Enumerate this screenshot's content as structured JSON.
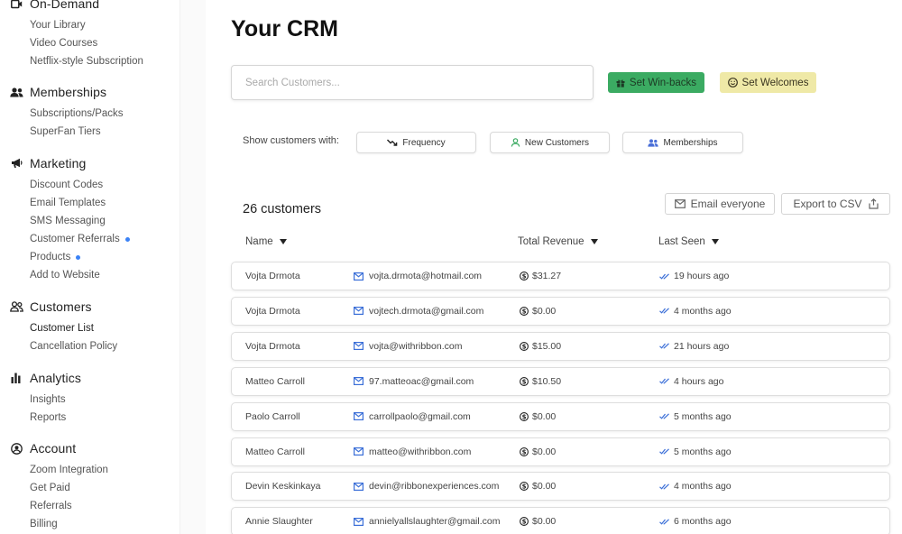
{
  "sidebar": {
    "sections": [
      {
        "label": "On-Demand",
        "icon": "video-icon",
        "items": [
          {
            "label": "Your Library"
          },
          {
            "label": "Video Courses"
          },
          {
            "label": "Netflix-style Subscription"
          }
        ]
      },
      {
        "label": "Memberships",
        "icon": "users-icon",
        "items": [
          {
            "label": "Subscriptions/Packs"
          },
          {
            "label": "SuperFan Tiers"
          }
        ]
      },
      {
        "label": "Marketing",
        "icon": "megaphone-icon",
        "items": [
          {
            "label": "Discount Codes"
          },
          {
            "label": "Email Templates"
          },
          {
            "label": "SMS Messaging"
          },
          {
            "label": "Customer Referrals",
            "dot": true
          },
          {
            "label": "Products",
            "dot": true
          },
          {
            "label": "Add to Website"
          }
        ]
      },
      {
        "label": "Customers",
        "icon": "people-outline-icon",
        "items": [
          {
            "label": "Customer List",
            "active": true
          },
          {
            "label": "Cancellation Policy"
          }
        ]
      },
      {
        "label": "Analytics",
        "icon": "bar-chart-icon",
        "items": [
          {
            "label": "Insights"
          },
          {
            "label": "Reports"
          }
        ]
      },
      {
        "label": "Account",
        "icon": "user-circle-icon",
        "items": [
          {
            "label": "Zoom Integration"
          },
          {
            "label": "Get Paid"
          },
          {
            "label": "Referrals"
          },
          {
            "label": "Billing"
          }
        ]
      }
    ]
  },
  "main": {
    "title": "Your CRM",
    "search_placeholder": "Search Customers...",
    "winback_label": "Set Win-backs",
    "welcome_label": "Set Welcomes",
    "filter_label": "Show customers with:",
    "filters": {
      "frequency": "Frequency",
      "new_customers": "New Customers",
      "memberships": "Memberships"
    },
    "count_label": "26 customers",
    "email_everyone_label": "Email everyone",
    "export_label": "Export to CSV",
    "columns": {
      "name": "Name",
      "revenue": "Total Revenue",
      "last_seen": "Last Seen"
    }
  },
  "customers": [
    {
      "name": "Vojta Drmota",
      "email": "vojta.drmota@hotmail.com",
      "revenue": "$31.27",
      "last_seen": "19 hours ago"
    },
    {
      "name": "Vojta Drmota",
      "email": "vojtech.drmota@gmail.com",
      "revenue": "$0.00",
      "last_seen": "4 months ago"
    },
    {
      "name": "Vojta Drmota",
      "email": "vojta@withribbon.com",
      "revenue": "$15.00",
      "last_seen": "21 hours ago"
    },
    {
      "name": "Matteo Carroll",
      "email": "97.matteoac@gmail.com",
      "revenue": "$10.50",
      "last_seen": "4 hours ago"
    },
    {
      "name": "Paolo Carroll",
      "email": "carrollpaolo@gmail.com",
      "revenue": "$0.00",
      "last_seen": "5 months ago"
    },
    {
      "name": "Matteo Carroll",
      "email": "matteo@withribbon.com",
      "revenue": "$0.00",
      "last_seen": "5 months ago"
    },
    {
      "name": "Devin Keskinkaya",
      "email": "devin@ribbonexperiences.com",
      "revenue": "$0.00",
      "last_seen": "4 months ago"
    },
    {
      "name": "Annie Slaughter",
      "email": "annielyallslaughter@gmail.com",
      "revenue": "$0.00",
      "last_seen": "6 months ago"
    }
  ],
  "colors": {
    "accent": "#3b82f6",
    "winback": "#3bab62",
    "welcome": "#efe9a7"
  }
}
